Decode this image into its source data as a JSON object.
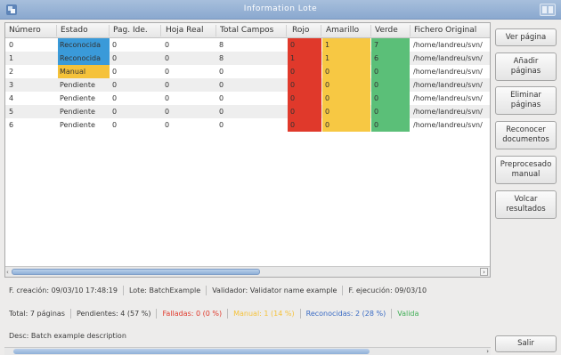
{
  "window": {
    "title": "Information Lote"
  },
  "table": {
    "headers": [
      "Número",
      "Estado",
      "Pag. Ide.",
      "Hoja Real",
      "Total Campos",
      "Rojo",
      "Amarillo",
      "Verde",
      "Fichero Original"
    ],
    "rows": [
      {
        "numero": "0",
        "estado": "Reconocida",
        "pag": "0",
        "hoja": "0",
        "total": "8",
        "rojo": "0",
        "amarillo": "1",
        "verde": "7",
        "fichero": "/home/landreu/svn/"
      },
      {
        "numero": "1",
        "estado": "Reconocida",
        "pag": "0",
        "hoja": "0",
        "total": "8",
        "rojo": "1",
        "amarillo": "1",
        "verde": "6",
        "fichero": "/home/landreu/svn/"
      },
      {
        "numero": "2",
        "estado": "Manual",
        "pag": "0",
        "hoja": "0",
        "total": "0",
        "rojo": "0",
        "amarillo": "0",
        "verde": "0",
        "fichero": "/home/landreu/svn/"
      },
      {
        "numero": "3",
        "estado": "Pendiente",
        "pag": "0",
        "hoja": "0",
        "total": "0",
        "rojo": "0",
        "amarillo": "0",
        "verde": "0",
        "fichero": "/home/landreu/svn/"
      },
      {
        "numero": "4",
        "estado": "Pendiente",
        "pag": "0",
        "hoja": "0",
        "total": "0",
        "rojo": "0",
        "amarillo": "0",
        "verde": "0",
        "fichero": "/home/landreu/svn/"
      },
      {
        "numero": "5",
        "estado": "Pendiente",
        "pag": "0",
        "hoja": "0",
        "total": "0",
        "rojo": "0",
        "amarillo": "0",
        "verde": "0",
        "fichero": "/home/landreu/svn/"
      },
      {
        "numero": "6",
        "estado": "Pendiente",
        "pag": "0",
        "hoja": "0",
        "total": "0",
        "rojo": "0",
        "amarillo": "0",
        "verde": "0",
        "fichero": "/home/landreu/svn/"
      }
    ],
    "status_colors": {
      "Reconocida": "#3a9ad9",
      "Manual": "#f5c23a"
    },
    "column_colors": {
      "rojo": "#e0392b",
      "amarillo": "#f7c843",
      "verde": "#5bbf78"
    }
  },
  "info": {
    "creacion": "F. creación: 09/03/10 17:48:19",
    "lote": "Lote: BatchExample",
    "validador": "Validador: Validator name example",
    "ejecucion": "F. ejecución: 09/03/10",
    "total": "Total: 7 páginas",
    "pendientes": "Pendientes: 4 (57 %)",
    "falladas": "Falladas: 0 (0 %)",
    "manual": "Manual: 1 (14 %)",
    "reconocidas": "Reconocidas: 2 (28 %)",
    "validadas": "Valida",
    "desc": "Desc: Batch example description"
  },
  "info_colors": {
    "falladas": "#e0392b",
    "manual": "#f5c23a",
    "reconocidas": "#3a6bc4",
    "validadas": "#3fae55"
  },
  "buttons": {
    "ver_pagina": "Ver página",
    "anadir_paginas": "Añadir páginas",
    "eliminar_paginas": "Eliminar páginas",
    "reconocer_documentos": "Reconocer documentos",
    "preprocesado_manual": "Preprocesado manual",
    "volcar_resultados": "Volcar resultados",
    "salir": "Salir"
  }
}
